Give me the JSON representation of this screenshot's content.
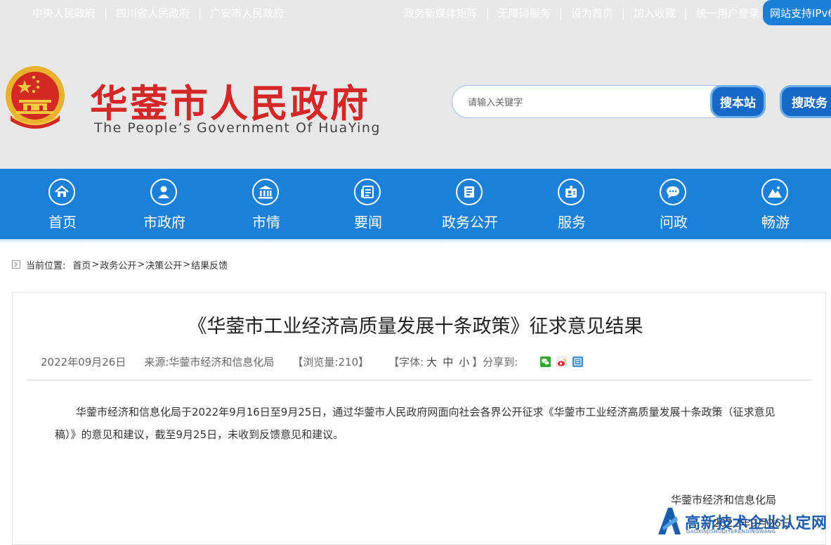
{
  "topbar": {
    "left_links": [
      "中央人民政府",
      "四川省人民政府",
      "广安市人民政府"
    ],
    "right_links": [
      "政务新媒体矩阵",
      "无障碍服务",
      "设为首页",
      "加入收藏",
      "统一用户登录"
    ],
    "separator": "|",
    "ipv6_label": "网站支持IPv6"
  },
  "header": {
    "title": "华蓥市人民政府",
    "subtitle": "The People’s Government Of HuaYing",
    "search": {
      "placeholder": "请输入关键字",
      "value": "",
      "site_button": "搜本站",
      "gov_button": "搜政务"
    }
  },
  "nav": {
    "items": [
      {
        "label": "首页",
        "icon": "home-icon"
      },
      {
        "label": "市政府",
        "icon": "person-icon"
      },
      {
        "label": "市情",
        "icon": "building-icon"
      },
      {
        "label": "要闻",
        "icon": "news-icon"
      },
      {
        "label": "政务公开",
        "icon": "document-icon"
      },
      {
        "label": "服务",
        "icon": "service-icon"
      },
      {
        "label": "问政",
        "icon": "chat-icon"
      },
      {
        "label": "畅游",
        "icon": "mountain-icon"
      }
    ]
  },
  "breadcrumb": {
    "label": "当前位置:",
    "items": [
      "首页",
      "政务公开",
      "决策公开",
      "结果反馈"
    ],
    "arrow": ">"
  },
  "article": {
    "title": "《华蓥市工业经济高质量发展十条政策》征求意见结果",
    "date": "2022年09月26日",
    "source": "来源:华蓥市经济和信息化局",
    "views": "【浏览量:210】",
    "font_label": "【字体:",
    "font_options": [
      "大",
      "中",
      "小"
    ],
    "font_end": "】分享到:",
    "body": "华蓥市经济和信息化局于2022年9月16日至9月25日，通过华蓥市人民政府网面向社会各界公开征求《华蓥市工业经济高质量发展十条政策（征求意见稿）》的意见和建议，截至9月25日，未收到反馈意见和建议。",
    "sign_org": "华蓥市经济和信息化局",
    "sign_date": "2022年9月26日"
  },
  "watermark": {
    "text": "高新技术企业认定网",
    "sub": "GAOXINJISHUQIYERENDINGWANG"
  },
  "colors": {
    "nav_blue": "#1c80d8",
    "title_red": "#d42727",
    "header_grey": "#e8e8e8"
  }
}
